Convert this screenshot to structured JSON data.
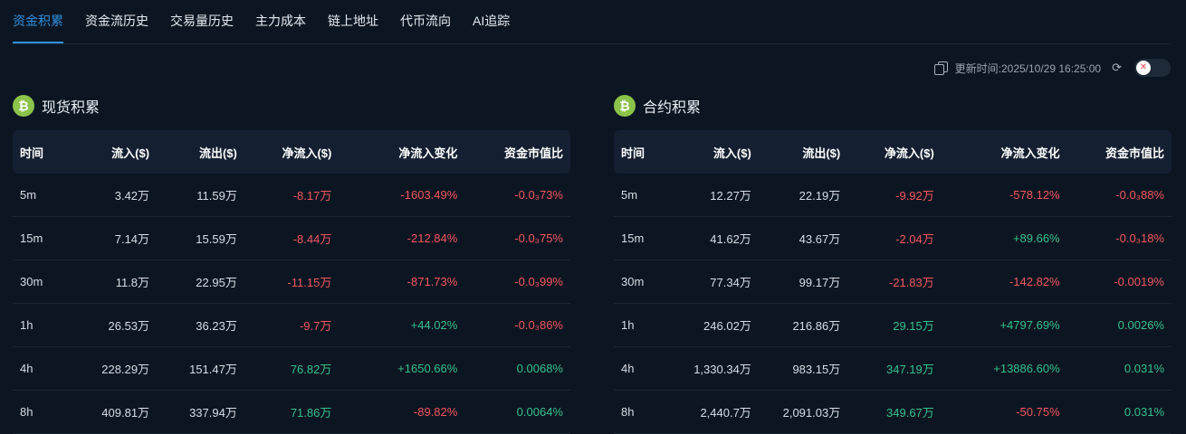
{
  "tabs": [
    {
      "label": "资金积累",
      "active": true
    },
    {
      "label": "资金流历史",
      "active": false
    },
    {
      "label": "交易量历史",
      "active": false
    },
    {
      "label": "主力成本",
      "active": false
    },
    {
      "label": "链上地址",
      "active": false
    },
    {
      "label": "代币流向",
      "active": false
    },
    {
      "label": "AI追踪",
      "active": false
    }
  ],
  "toolbar": {
    "updated_label": "更新时间:2025/10/29 16:25:00",
    "copy_icon": "copy-icon",
    "refresh_icon": "refresh-icon",
    "toggle_on": false
  },
  "colors": {
    "accent": "#2e8fde",
    "negative": "#f0575f",
    "positive": "#36c18b",
    "coin": "#8bc34a"
  },
  "headers": [
    "时间",
    "流入($)",
    "流出($)",
    "净流入($)",
    "净流入变化",
    "资金市值比"
  ],
  "spot": {
    "title": "现货积累",
    "rows": [
      {
        "time": "5m",
        "inflow": "3.42万",
        "outflow": "11.59万",
        "net": "-8.17万",
        "change": "-1603.49%",
        "ratio": "-0.0₃73%",
        "sign": "neg"
      },
      {
        "time": "15m",
        "inflow": "7.14万",
        "outflow": "15.59万",
        "net": "-8.44万",
        "change": "-212.84%",
        "ratio": "-0.0₃75%",
        "sign": "neg"
      },
      {
        "time": "30m",
        "inflow": "11.8万",
        "outflow": "22.95万",
        "net": "-11.15万",
        "change": "-871.73%",
        "ratio": "-0.0₃99%",
        "sign": "neg"
      },
      {
        "time": "1h",
        "inflow": "26.53万",
        "outflow": "36.23万",
        "net": "-9.7万",
        "change": "+44.02%",
        "ratio": "-0.0₃86%",
        "sign": "neg",
        "change_sign": "pos"
      },
      {
        "time": "4h",
        "inflow": "228.29万",
        "outflow": "151.47万",
        "net": "76.82万",
        "change": "+1650.66%",
        "ratio": "0.0068%",
        "sign": "pos"
      },
      {
        "time": "8h",
        "inflow": "409.81万",
        "outflow": "337.94万",
        "net": "71.86万",
        "change": "-89.82%",
        "ratio": "0.0064%",
        "sign": "pos",
        "change_sign": "neg"
      }
    ]
  },
  "futures": {
    "title": "合约积累",
    "rows": [
      {
        "time": "5m",
        "inflow": "12.27万",
        "outflow": "22.19万",
        "net": "-9.92万",
        "change": "-578.12%",
        "ratio": "-0.0₃88%",
        "sign": "neg"
      },
      {
        "time": "15m",
        "inflow": "41.62万",
        "outflow": "43.67万",
        "net": "-2.04万",
        "change": "+89.66%",
        "ratio": "-0.0₃18%",
        "sign": "neg",
        "change_sign": "pos"
      },
      {
        "time": "30m",
        "inflow": "77.34万",
        "outflow": "99.17万",
        "net": "-21.83万",
        "change": "-142.82%",
        "ratio": "-0.0019%",
        "sign": "neg"
      },
      {
        "time": "1h",
        "inflow": "246.02万",
        "outflow": "216.86万",
        "net": "29.15万",
        "change": "+4797.69%",
        "ratio": "0.0026%",
        "sign": "pos"
      },
      {
        "time": "4h",
        "inflow": "1,330.34万",
        "outflow": "983.15万",
        "net": "347.19万",
        "change": "+13886.60%",
        "ratio": "0.031%",
        "sign": "pos"
      },
      {
        "time": "8h",
        "inflow": "2,440.7万",
        "outflow": "2,091.03万",
        "net": "349.67万",
        "change": "-50.75%",
        "ratio": "0.031%",
        "sign": "pos",
        "change_sign": "neg"
      }
    ]
  }
}
